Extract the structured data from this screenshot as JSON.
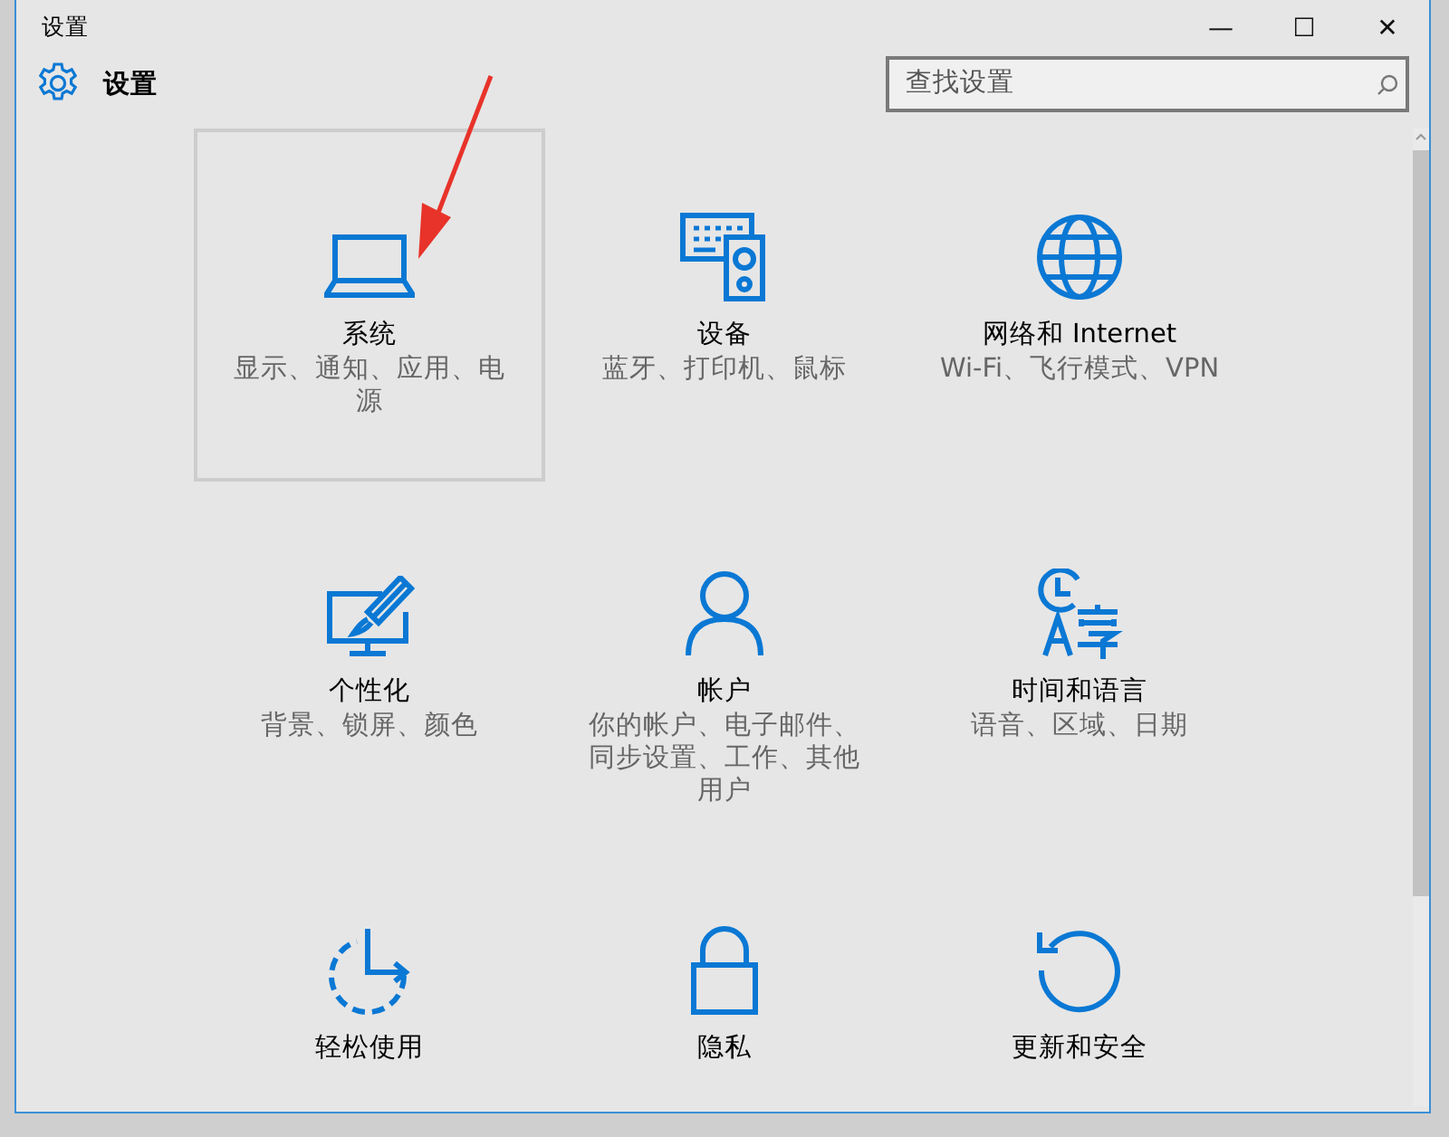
{
  "window": {
    "title": "设置",
    "minimize": "—",
    "maximize": "☐",
    "close": "✕"
  },
  "header": {
    "title": "设置"
  },
  "search": {
    "placeholder": "查找设置"
  },
  "tiles": [
    {
      "title": "系统",
      "description": "显示、通知、应用、电源",
      "selected": true
    },
    {
      "title": "设备",
      "description": "蓝牙、打印机、鼠标",
      "selected": false
    },
    {
      "title": "网络和 Internet",
      "description": "Wi-Fi、飞行模式、VPN",
      "selected": false
    },
    {
      "title": "个性化",
      "description": "背景、锁屏、颜色",
      "selected": false
    },
    {
      "title": "帐户",
      "description": "你的帐户、电子邮件、同步设置、工作、其他用户",
      "selected": false
    },
    {
      "title": "时间和语言",
      "description": "语音、区域、日期",
      "selected": false
    },
    {
      "title": "轻松使用",
      "selected": false
    },
    {
      "title": "隐私",
      "selected": false
    },
    {
      "title": "更新和安全",
      "selected": false
    }
  ]
}
